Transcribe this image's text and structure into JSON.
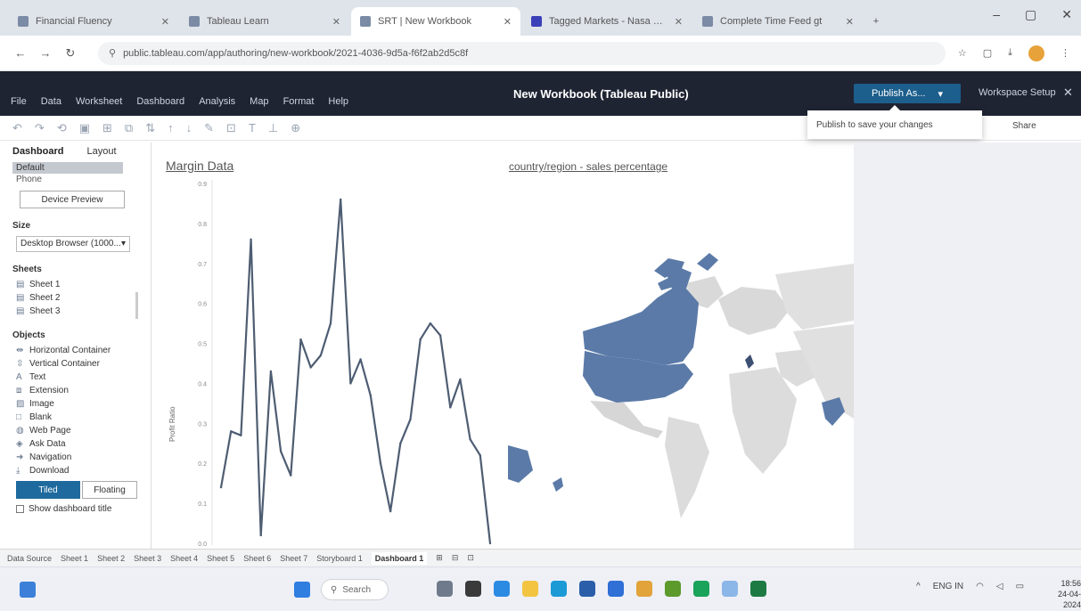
{
  "browser": {
    "tabs": [
      {
        "label": "Financial Fluency",
        "active": false
      },
      {
        "label": "Tableau Learn",
        "active": false
      },
      {
        "label": "SRT | New Workbook",
        "active": true
      },
      {
        "label": "Tagged Markets - Nasa Live",
        "active": false
      },
      {
        "label": "Complete Time Feed gt",
        "active": false
      }
    ],
    "url": "public.tableau.com/app/authoring/new-workbook/2021-4036-9d5a-f6f2ab2d5c8f",
    "new_tab_glyph": "+",
    "window_controls": [
      "–",
      "▢",
      "✕"
    ]
  },
  "tableau": {
    "menu": [
      "File",
      "Data",
      "Worksheet",
      "Dashboard",
      "Analysis",
      "Map",
      "Format",
      "Help"
    ],
    "title": "New Workbook (Tableau Public)",
    "publish_button": "Publish As...",
    "user": "Workspace Setup",
    "tooltip": "Publish to save your changes",
    "share": "Share"
  },
  "left_pane": {
    "tabs": [
      "Dashboard",
      "Layout"
    ],
    "device_selected": "Default",
    "device_sub": "Phone",
    "device_button": "Device Preview",
    "size_label": "Size",
    "size_value": "Desktop Browser (1000...",
    "sheets_label": "Sheets",
    "sheets": [
      "Sheet 1",
      "Sheet 2",
      "Sheet 3"
    ],
    "objects_label": "Objects",
    "objects": [
      "Horizontal Container",
      "Vertical Container",
      "Text",
      "Extension",
      "Image",
      "Blank",
      "Web Page",
      "Ask Data",
      "Navigation",
      "Download"
    ],
    "tiled": "Tiled",
    "floating": "Floating",
    "show_title": "Show dashboard title"
  },
  "dashboard": {
    "chart1_title": "Margin Data",
    "chart2_title": "country/region - sales percentage",
    "y_axis_label": "Profit Ratio"
  },
  "chart_data": {
    "type": "line",
    "title": "Margin Data",
    "ylabel": "Profit Ratio",
    "y_ticks": [
      "0.0",
      "0.1",
      "0.2",
      "0.3",
      "0.4",
      "0.5",
      "0.6",
      "0.7",
      "0.8",
      "0.9"
    ],
    "ylim": [
      0,
      0.9
    ],
    "values": [
      0.14,
      0.28,
      0.27,
      0.76,
      0.02,
      0.43,
      0.23,
      0.17,
      0.51,
      0.44,
      0.47,
      0.55,
      0.86,
      0.4,
      0.46,
      0.37,
      0.2,
      0.08,
      0.25,
      0.31,
      0.51,
      0.55,
      0.52,
      0.34,
      0.41,
      0.26,
      0.22,
      0.0
    ],
    "line_color": "#4e5d72",
    "region_color": "#5b7aa8"
  },
  "sheet_tabs": [
    "Data Source",
    "Sheet 1",
    "Sheet 2",
    "Sheet 3",
    "Sheet 4",
    "Sheet 5",
    "Sheet 6",
    "Sheet 7",
    "Storyboard 1",
    "Dashboard 1"
  ],
  "taskbar": {
    "search": "Search",
    "tray_lang": "ENG IN",
    "time": "18:56",
    "date": "24-04-2024"
  }
}
